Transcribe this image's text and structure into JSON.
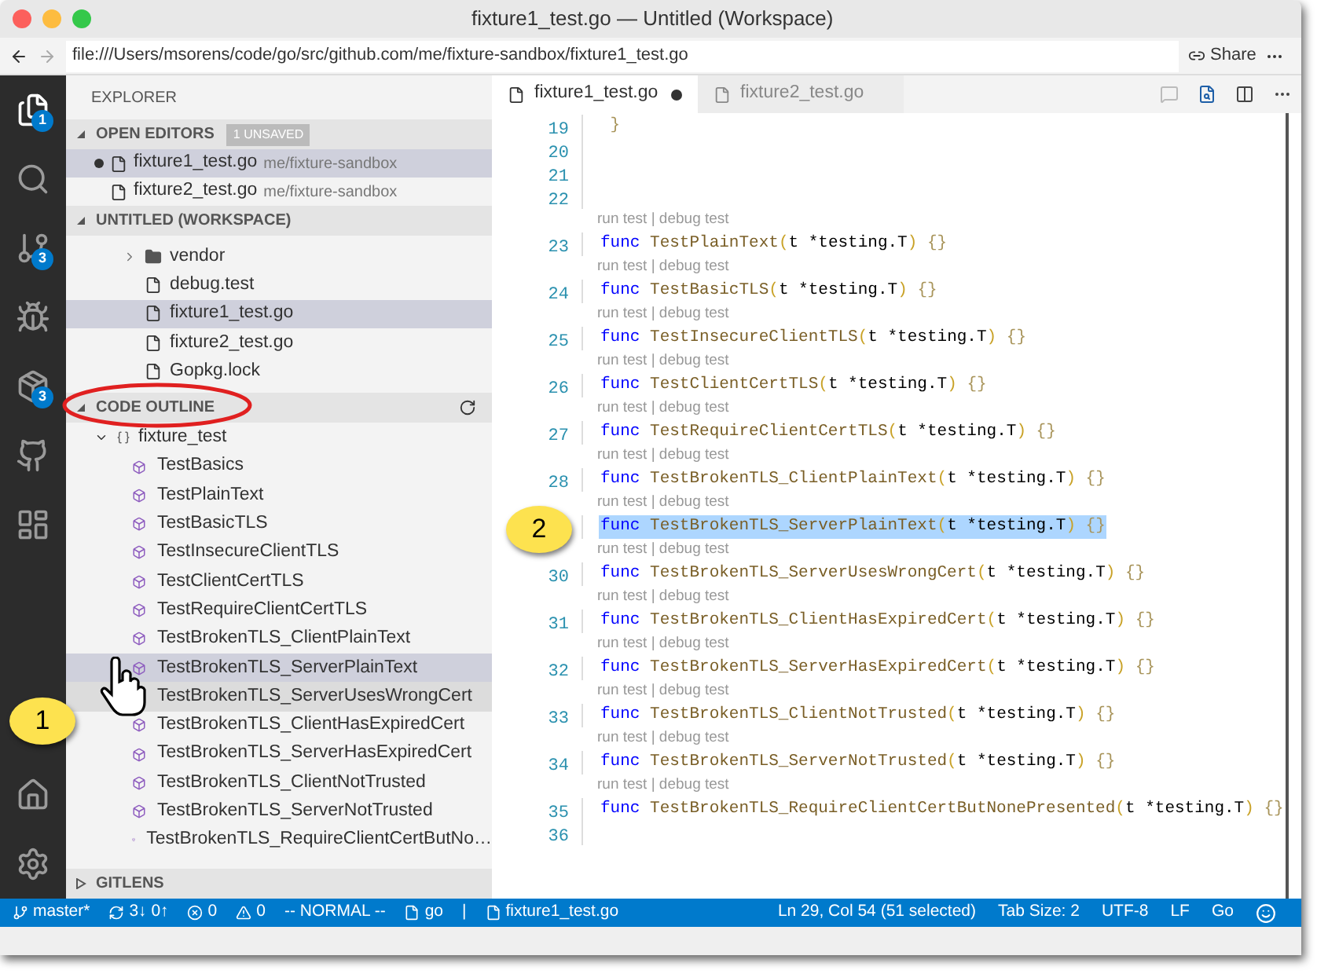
{
  "window": {
    "title": "fixture1_test.go — Untitled (Workspace)"
  },
  "address_bar": {
    "url": "file:///Users/msorens/code/go/src/github.com/me/fixture-sandbox/fixture1_test.go",
    "share": "Share"
  },
  "activity_bar": [
    {
      "kind": "files",
      "badge": "1",
      "selected": true
    },
    {
      "kind": "search",
      "selected": false
    },
    {
      "kind": "source-control",
      "badge": "3",
      "selected": false
    },
    {
      "kind": "debug",
      "selected": false
    },
    {
      "kind": "extensions",
      "badge": "3",
      "selected": false
    },
    {
      "kind": "github",
      "selected": false
    },
    {
      "kind": "panel",
      "selected": false
    },
    {
      "kind": "home",
      "selected": false
    },
    {
      "kind": "settings",
      "selected": false
    }
  ],
  "sidebar": {
    "title": "EXPLORER",
    "open_editors": {
      "title": "OPEN EDITORS",
      "badge": "1 UNSAVED",
      "items": [
        {
          "name": "fixture1_test.go",
          "path": "me/fixture-sandbox",
          "dirty": true,
          "selected": true
        },
        {
          "name": "fixture2_test.go",
          "path": "me/fixture-sandbox",
          "dirty": false,
          "selected": false
        }
      ]
    },
    "workspace": {
      "title": "UNTITLED (WORKSPACE)",
      "items": [
        {
          "kind": "folder",
          "name": "vendor",
          "selected": false
        },
        {
          "kind": "file",
          "name": "debug.test",
          "selected": false
        },
        {
          "kind": "file",
          "name": "fixture1_test.go",
          "selected": true
        },
        {
          "kind": "file",
          "name": "fixture2_test.go",
          "selected": false
        },
        {
          "kind": "file",
          "name": "Gopkg.lock",
          "selected": false
        }
      ]
    },
    "code_outline": {
      "title": "CODE OUTLINE",
      "root": {
        "label": "fixture_test",
        "expanded": true,
        "children": [
          {
            "label": "TestBasics",
            "selected": false,
            "hovered": false
          },
          {
            "label": "TestPlainText",
            "selected": false,
            "hovered": false
          },
          {
            "label": "TestBasicTLS",
            "selected": false,
            "hovered": false
          },
          {
            "label": "TestInsecureClientTLS",
            "selected": false,
            "hovered": false
          },
          {
            "label": "TestClientCertTLS",
            "selected": false,
            "hovered": false
          },
          {
            "label": "TestRequireClientCertTLS",
            "selected": false,
            "hovered": false
          },
          {
            "label": "TestBrokenTLS_ClientPlainText",
            "selected": false,
            "hovered": false
          },
          {
            "label": "TestBrokenTLS_ServerPlainText",
            "selected": true,
            "hovered": false
          },
          {
            "label": "TestBrokenTLS_ServerUsesWrongCert",
            "selected": false,
            "hovered": true
          },
          {
            "label": "TestBrokenTLS_ClientHasExpiredCert",
            "selected": false,
            "hovered": false
          },
          {
            "label": "TestBrokenTLS_ServerHasExpiredCert",
            "selected": false,
            "hovered": false
          },
          {
            "label": "TestBrokenTLS_ClientNotTrusted",
            "selected": false,
            "hovered": false
          },
          {
            "label": "TestBrokenTLS_ServerNotTrusted",
            "selected": false,
            "hovered": false
          },
          {
            "label": "TestBrokenTLS_RequireClientCertButNo…",
            "selected": false,
            "hovered": false
          }
        ]
      }
    },
    "gitlens": {
      "title": "GITLENS",
      "expanded": false
    }
  },
  "editor": {
    "tabs": [
      {
        "label": "fixture1_test.go",
        "dirty": true,
        "selected": true
      },
      {
        "label": "fixture2_test.go",
        "dirty": false,
        "selected": false
      }
    ],
    "lines": [
      {
        "number": "19",
        "selected": false,
        "tokens": [
          {
            "kind": "brace",
            "text": "}"
          }
        ]
      },
      {
        "number": "20",
        "selected": false
      },
      {
        "number": "21",
        "selected": false
      },
      {
        "number": "22",
        "selected": false
      },
      {
        "number": "23",
        "lens": "run test | debug test",
        "selected": false,
        "tokens": [
          {
            "kind": "keyword",
            "text": "func"
          },
          {
            "kind": "function",
            "text": "TestPlainText"
          },
          {
            "kind": "paren",
            "text": "("
          },
          {
            "kind": "param",
            "text": "t *testing.T"
          },
          {
            "kind": "paren",
            "text": ")"
          },
          {
            "kind": "brace",
            "text": "{}"
          }
        ]
      },
      {
        "number": "24",
        "lens": "run test | debug test",
        "selected": false,
        "tokens": [
          {
            "kind": "keyword",
            "text": "func"
          },
          {
            "kind": "function",
            "text": "TestBasicTLS"
          },
          {
            "kind": "paren",
            "text": "("
          },
          {
            "kind": "param",
            "text": "t *testing.T"
          },
          {
            "kind": "paren",
            "text": ")"
          },
          {
            "kind": "brace",
            "text": "{}"
          }
        ]
      },
      {
        "number": "25",
        "lens": "run test | debug test",
        "selected": false,
        "tokens": [
          {
            "kind": "keyword",
            "text": "func"
          },
          {
            "kind": "function",
            "text": "TestInsecureClientTLS"
          },
          {
            "kind": "paren",
            "text": "("
          },
          {
            "kind": "param",
            "text": "t *testing.T"
          },
          {
            "kind": "paren",
            "text": ")"
          },
          {
            "kind": "brace",
            "text": "{}"
          }
        ]
      },
      {
        "number": "26",
        "lens": "run test | debug test",
        "selected": false,
        "tokens": [
          {
            "kind": "keyword",
            "text": "func"
          },
          {
            "kind": "function",
            "text": "TestClientCertTLS"
          },
          {
            "kind": "paren",
            "text": "("
          },
          {
            "kind": "param",
            "text": "t *testing.T"
          },
          {
            "kind": "paren",
            "text": ")"
          },
          {
            "kind": "brace",
            "text": "{}"
          }
        ]
      },
      {
        "number": "27",
        "lens": "run test | debug test",
        "selected": false,
        "tokens": [
          {
            "kind": "keyword",
            "text": "func"
          },
          {
            "kind": "function",
            "text": "TestRequireClientCertTLS"
          },
          {
            "kind": "paren",
            "text": "("
          },
          {
            "kind": "param",
            "text": "t *testing.T"
          },
          {
            "kind": "paren",
            "text": ")"
          },
          {
            "kind": "brace",
            "text": "{}"
          }
        ]
      },
      {
        "number": "28",
        "lens": "run test | debug test",
        "selected": false,
        "tokens": [
          {
            "kind": "keyword",
            "text": "func"
          },
          {
            "kind": "function",
            "text": "TestBrokenTLS_ClientPlainText"
          },
          {
            "kind": "paren",
            "text": "("
          },
          {
            "kind": "param",
            "text": "t *testing.T"
          },
          {
            "kind": "paren",
            "text": ")"
          },
          {
            "kind": "brace",
            "text": "{}"
          }
        ]
      },
      {
        "lens": "run test | debug test",
        "selected": true,
        "tokens": [
          {
            "kind": "keyword",
            "text": "func"
          },
          {
            "kind": "function",
            "text": "TestBrokenTLS_ServerPlainText"
          },
          {
            "kind": "paren",
            "text": "("
          },
          {
            "kind": "param",
            "text": "t *testing.T"
          },
          {
            "kind": "paren",
            "text": ")"
          },
          {
            "kind": "brace",
            "text": "{}"
          }
        ]
      },
      {
        "number": "30",
        "lens": "run test | debug test",
        "selected": false,
        "tokens": [
          {
            "kind": "keyword",
            "text": "func"
          },
          {
            "kind": "function",
            "text": "TestBrokenTLS_ServerUsesWrongCert"
          },
          {
            "kind": "paren",
            "text": "("
          },
          {
            "kind": "param",
            "text": "t *testing.T"
          },
          {
            "kind": "paren",
            "text": ")"
          },
          {
            "kind": "brace",
            "text": "{}"
          }
        ]
      },
      {
        "number": "31",
        "lens": "run test | debug test",
        "selected": false,
        "tokens": [
          {
            "kind": "keyword",
            "text": "func"
          },
          {
            "kind": "function",
            "text": "TestBrokenTLS_ClientHasExpiredCert"
          },
          {
            "kind": "paren",
            "text": "("
          },
          {
            "kind": "param",
            "text": "t *testing.T"
          },
          {
            "kind": "paren",
            "text": ")"
          },
          {
            "kind": "brace",
            "text": "{}"
          }
        ]
      },
      {
        "number": "32",
        "lens": "run test | debug test",
        "selected": false,
        "tokens": [
          {
            "kind": "keyword",
            "text": "func"
          },
          {
            "kind": "function",
            "text": "TestBrokenTLS_ServerHasExpiredCert"
          },
          {
            "kind": "paren",
            "text": "("
          },
          {
            "kind": "param",
            "text": "t *testing.T"
          },
          {
            "kind": "paren",
            "text": ")"
          },
          {
            "kind": "brace",
            "text": "{}"
          }
        ]
      },
      {
        "number": "33",
        "lens": "run test | debug test",
        "selected": false,
        "tokens": [
          {
            "kind": "keyword",
            "text": "func"
          },
          {
            "kind": "function",
            "text": "TestBrokenTLS_ClientNotTrusted"
          },
          {
            "kind": "paren",
            "text": "("
          },
          {
            "kind": "param",
            "text": "t *testing.T"
          },
          {
            "kind": "paren",
            "text": ")"
          },
          {
            "kind": "brace",
            "text": "{}"
          }
        ]
      },
      {
        "number": "34",
        "lens": "run test | debug test",
        "selected": false,
        "tokens": [
          {
            "kind": "keyword",
            "text": "func"
          },
          {
            "kind": "function",
            "text": "TestBrokenTLS_ServerNotTrusted"
          },
          {
            "kind": "paren",
            "text": "("
          },
          {
            "kind": "param",
            "text": "t *testing.T"
          },
          {
            "kind": "paren",
            "text": ")"
          },
          {
            "kind": "brace",
            "text": "{}"
          }
        ]
      },
      {
        "number": "35",
        "lens": "run test | debug test",
        "selected": false,
        "tokens": [
          {
            "kind": "keyword",
            "text": "func"
          },
          {
            "kind": "function",
            "text": "TestBrokenTLS_RequireClientCertButNonePresented"
          },
          {
            "kind": "paren",
            "text": "("
          },
          {
            "kind": "param",
            "text": "t *testing.T"
          },
          {
            "kind": "paren",
            "text": ")"
          },
          {
            "kind": "brace",
            "text": "{}"
          }
        ]
      },
      {
        "number": "36",
        "selected": false
      }
    ]
  },
  "status_bar": {
    "left": [
      {
        "kind": "branch",
        "text": "master*"
      },
      {
        "kind": "sync",
        "text": "3↓ 0↑"
      },
      {
        "kind": "errors",
        "text": "0"
      },
      {
        "kind": "warnings",
        "text": "0"
      },
      {
        "kind": "plain",
        "text": "-- NORMAL --"
      },
      {
        "kind": "file",
        "text": "go"
      },
      {
        "kind": "plain",
        "text": "|"
      },
      {
        "kind": "file",
        "text": "fixture1_test.go"
      }
    ],
    "right": [
      {
        "kind": "plain",
        "text": "Ln 29, Col 54 (51 selected)"
      },
      {
        "kind": "plain",
        "text": "Tab Size: 2"
      },
      {
        "kind": "plain",
        "text": "UTF-8"
      },
      {
        "kind": "plain",
        "text": "LF"
      },
      {
        "kind": "plain",
        "text": "Go"
      },
      {
        "kind": "feedback"
      }
    ]
  },
  "callouts": [
    {
      "label": "1"
    },
    {
      "label": "2"
    }
  ]
}
